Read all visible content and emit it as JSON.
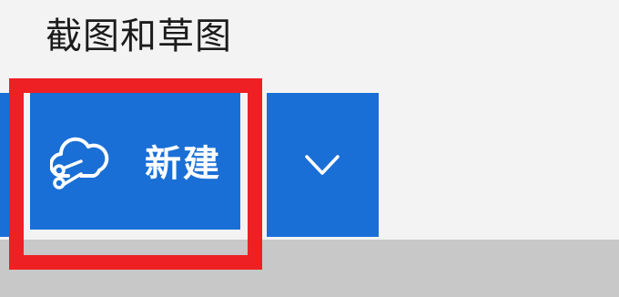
{
  "app": {
    "title": "截图和草图"
  },
  "toolbar": {
    "new_button_label": "新建",
    "new_button_icon": "snip-cloud-scissors-icon",
    "dropdown_icon": "chevron-down-icon"
  },
  "annotation": {
    "highlight_color": "#ee2024"
  },
  "colors": {
    "accent": "#1a6fd6",
    "background": "#f3f3f3"
  }
}
